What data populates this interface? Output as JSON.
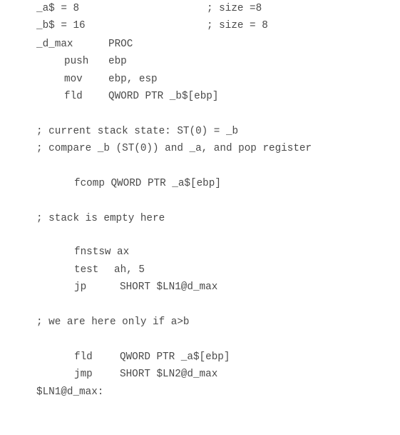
{
  "code": {
    "a_decl": "_a$ = 8",
    "a_comment": "; size =8",
    "b_decl": "_b$ = 16",
    "b_comment": "; size = 8",
    "proc_label": "_d_max",
    "proc_kw": "PROC",
    "push_op": "push",
    "push_arg": "ebp",
    "mov_op": "mov",
    "mov_arg": "ebp, esp",
    "fld_b_op": "fld",
    "fld_b_arg": "QWORD PTR _b$[ebp]",
    "comment_stack_state": "; current stack state: ST(0) = _b",
    "comment_compare": "; compare _b (ST(0)) and _a, and pop register",
    "fcomp_line": "fcomp QWORD PTR _a$[ebp]",
    "comment_empty": "; stack is empty here",
    "fnstsw_line": "fnstsw ax",
    "test_op": "test",
    "test_arg": "ah, 5",
    "jp_op": "jp",
    "jp_arg": "SHORT $LN1@d_max",
    "comment_a_gt_b": "; we are here only if a>b",
    "fld_a_op": "fld",
    "fld_a_arg": "QWORD PTR _a$[ebp]",
    "jmp_op": "jmp",
    "jmp_arg": "SHORT $LN2@d_max",
    "ln1_label": "$LN1@d_max:"
  }
}
